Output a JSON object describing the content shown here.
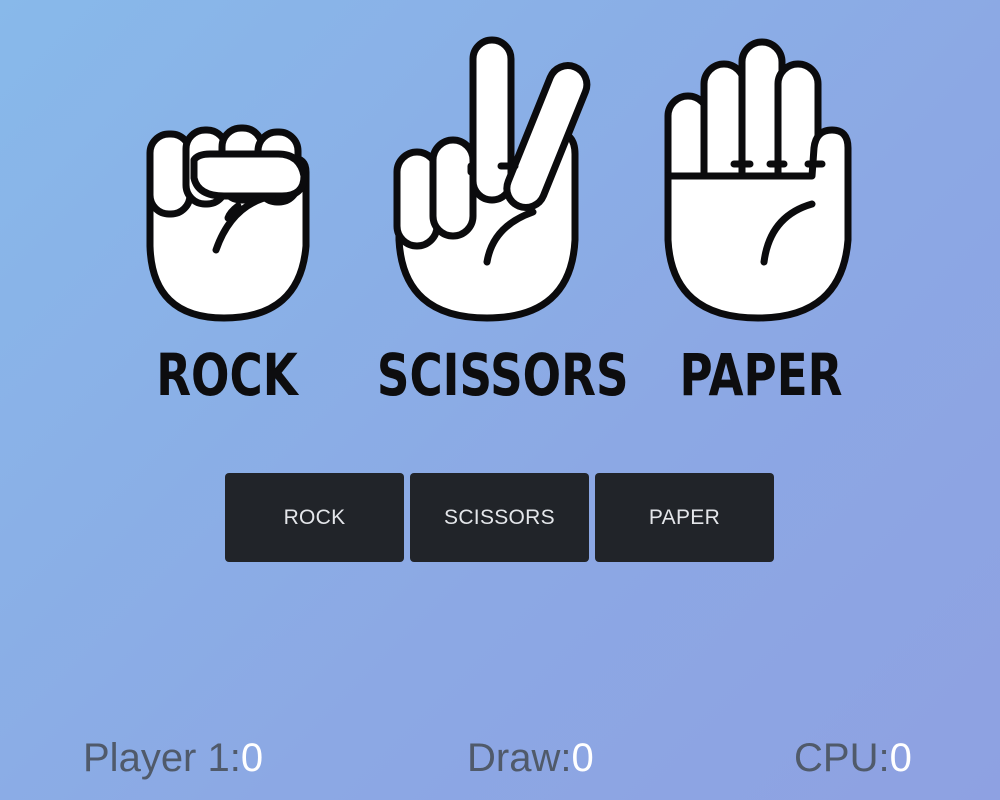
{
  "hands": [
    {
      "id": "rock",
      "label": "ROCK",
      "icon": "fist-icon"
    },
    {
      "id": "scissors",
      "label": "SCISSORS",
      "icon": "peace-sign-hand-icon"
    },
    {
      "id": "paper",
      "label": "PAPER",
      "icon": "open-palm-icon"
    }
  ],
  "buttons": {
    "rock": "ROCK",
    "scissors": "SCISSORS",
    "paper": "PAPER"
  },
  "scoreboard": {
    "player_label": "Player 1:",
    "player_score": "0",
    "draw_label": "Draw:",
    "draw_score": "0",
    "cpu_label": "CPU:",
    "cpu_score": "0"
  },
  "colors": {
    "background_start": "#88b9ea",
    "background_end": "#8ea1e2",
    "button_bg": "#212429",
    "button_text": "#e4e6ea",
    "label_text": "#0d0d0f",
    "score_label": "#505a6a",
    "score_value": "#ffffff"
  }
}
